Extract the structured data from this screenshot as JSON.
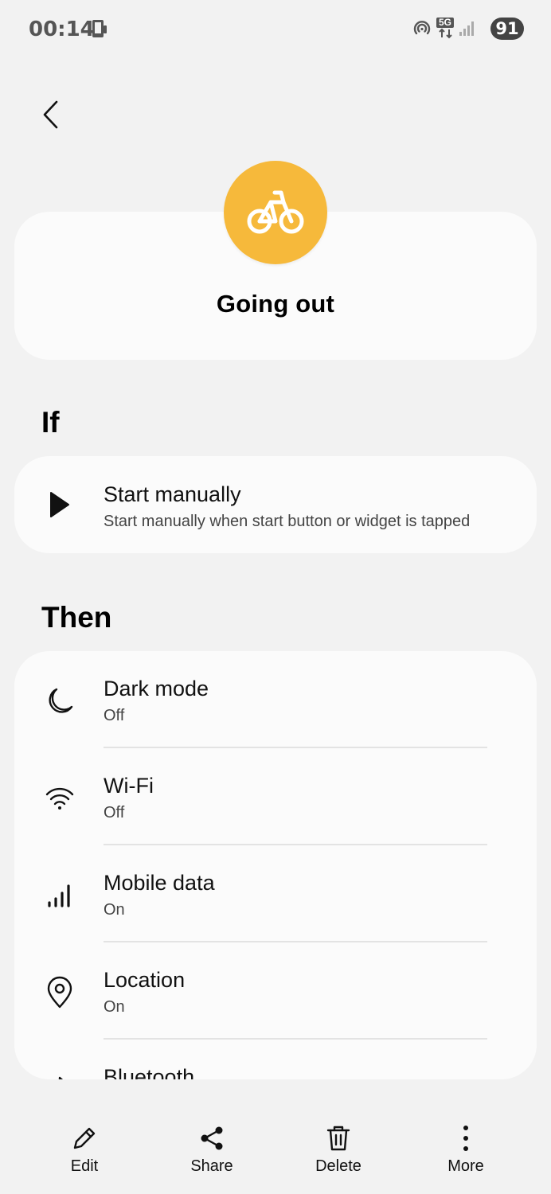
{
  "status_bar": {
    "time": "00:14",
    "network": "5G",
    "battery": "91"
  },
  "header": {
    "title": "Going out",
    "icon": "bicycle-icon",
    "icon_color": "#f6b93b"
  },
  "if_section": {
    "title": "If",
    "trigger": {
      "icon": "play-icon",
      "title": "Start manually",
      "subtitle": "Start manually when start button or widget is tapped"
    }
  },
  "then_section": {
    "title": "Then",
    "actions": [
      {
        "icon": "moon-icon",
        "title": "Dark mode",
        "value": "Off"
      },
      {
        "icon": "wifi-icon",
        "title": "Wi-Fi",
        "value": "Off"
      },
      {
        "icon": "signal-bars-icon",
        "title": "Mobile data",
        "value": "On"
      },
      {
        "icon": "location-pin-icon",
        "title": "Location",
        "value": "On"
      },
      {
        "icon": "bluetooth-icon",
        "title": "Bluetooth",
        "value": ""
      }
    ]
  },
  "bottom_bar": {
    "edit": "Edit",
    "share": "Share",
    "delete": "Delete",
    "more": "More"
  }
}
